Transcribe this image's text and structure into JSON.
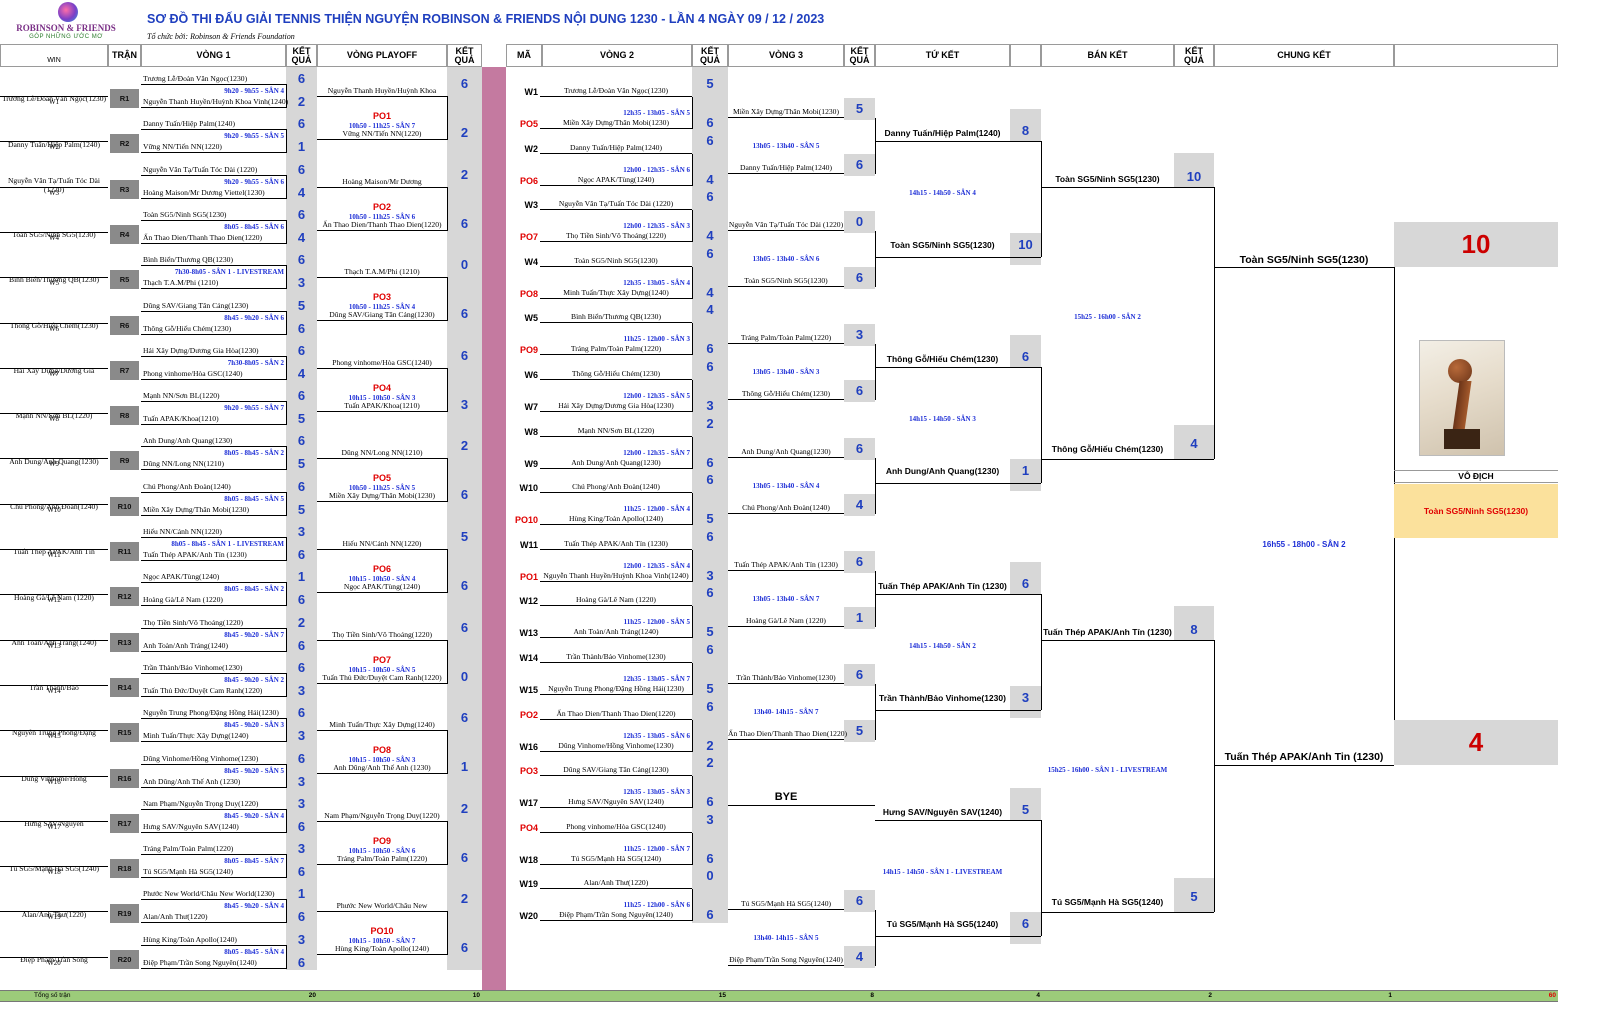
{
  "header": {
    "title": "SƠ ĐỒ THI ĐẤU GIẢI TENNIS THIỆN NGUYỆN ROBINSON & FRIENDS NỘI DUNG 1230 -  LẦN 4 NGÀY 09 / 12 / 2023",
    "organizer": "Tổ chức bởi: Robinson & Friends Foundation",
    "logo_text": "ROBINSON & FRIENDS",
    "logo_slogan": "GÓP NHỮNG ƯỚC MƠ"
  },
  "columns": {
    "win": "WIN",
    "tran": "TRẬN",
    "vong1": "VÒNG 1",
    "ketqua": "KẾT QUẢ",
    "playoff": "VÒNG PLAYOFF",
    "ma": "MÃ",
    "vong2": "VÒNG 2",
    "vong3": "VÒNG 3",
    "tuket": "TỨ KẾT",
    "banket": "BÁN KẾT",
    "chungket": "CHUNG KẾT"
  },
  "round1": [
    {
      "win": "Trương Lễ/Đoàn Văn Ngọc(1230)",
      "w": "W1",
      "r": "R1",
      "p1": "Trương Lễ/Đoàn Văn Ngọc(1230)",
      "p2": "Nguyễn Thanh Huyền/Huỳnh Khoa Vinh(1240)",
      "s1": "6",
      "s2": "2",
      "time": "9h20 - 9h55 - SÂN 4"
    },
    {
      "win": "Danny Tuấn/Hiệp Palm(1240)",
      "w": "W2",
      "r": "R2",
      "p1": "Danny Tuấn/Hiệp Palm(1240)",
      "p2": "Vững NN/Tiến NN(1220)",
      "s1": "6",
      "s2": "1",
      "time": "9h20 - 9h55 - SÂN 5"
    },
    {
      "win": "Nguyễn Văn Tạ/Tuấn Tóc Dài (1220)",
      "w": "W3",
      "r": "R3",
      "p1": "Nguyễn Văn Tạ/Tuấn Tóc Dài (1220)",
      "p2": "Hoàng Maison/Mr Dương Viettel(1230)",
      "s1": "6",
      "s2": "4",
      "time": "9h20 - 9h55 - SÂN 6"
    },
    {
      "win": "Toàn SG5/Ninh SG5(1230)",
      "w": "W4",
      "r": "R4",
      "p1": "Toàn SG5/Ninh SG5(1230)",
      "p2": "Ấn Thao Dien/Thanh Thao Dien(1220)",
      "s1": "6",
      "s2": "4",
      "time": "8h05 - 8h45 - SÂN 6"
    },
    {
      "win": "Bình Biển/Thương QB(1230)",
      "w": "W5",
      "r": "R5",
      "p1": "Bình Biển/Thương QB(1230)",
      "p2": "Thạch T.A.M/Phi (1210)",
      "s1": "6",
      "s2": "3",
      "time": "7h30-8h05 - SÂN 1 - LIVESTREAM"
    },
    {
      "win": "Thông Gỗ/Hiếu Chém(1230)",
      "w": "W6",
      "r": "R6",
      "p1": "Dũng SAV/Giang Tân Cảng(1230)",
      "p2": "Thông Gỗ/Hiếu Chém(1230)",
      "s1": "5",
      "s2": "6",
      "time": "8h45 - 9h20 - SÂN 6"
    },
    {
      "win": "Hải Xây Dựng/Dương Gia",
      "w": "W7",
      "r": "R7",
      "p1": "Hải Xây Dựng/Dương Gia Hòa(1230)",
      "p2": "Phong vinhome/Hòa GSC(1240)",
      "s1": "6",
      "s2": "4",
      "time": "7h30-8h05 - SÂN 2"
    },
    {
      "win": "Mạnh NN/Sơn BL(1220)",
      "w": "W8",
      "r": "R8",
      "p1": "Mạnh NN/Sơn BL(1220)",
      "p2": "Tuấn APAK/Khoa(1210)",
      "s1": "6",
      "s2": "5",
      "time": "9h20 - 9h55 - SÂN 7"
    },
    {
      "win": "Anh Dung/Anh Quang(1230)",
      "w": "W9",
      "r": "R9",
      "p1": "Anh Dung/Anh Quang(1230)",
      "p2": "Dũng NN/Long NN(1210)",
      "s1": "6",
      "s2": "5",
      "time": "8h05 - 8h45 - SÂN 2"
    },
    {
      "win": "Chú Phong/Anh Đoàn(1240)",
      "w": "W10",
      "r": "R10",
      "p1": "Chú Phong/Anh Đoàn(1240)",
      "p2": "Miền Xây Dựng/Thân Mobi(1230)",
      "s1": "6",
      "s2": "5",
      "time": "8h05 - 8h45 - SÂN 5"
    },
    {
      "win": "Tuấn Thép APAK/Anh Tín",
      "w": "W11",
      "r": "R11",
      "p1": "Hiếu NN/Cảnh NN(1220)",
      "p2": "Tuấn Thép APAK/Anh Tín (1230)",
      "s1": "3",
      "s2": "6",
      "time": "8h05 - 8h45 - SÂN 1 - LIVESTREAM"
    },
    {
      "win": "Hoàng Gà/Lê Nam (1220)",
      "w": "W12",
      "r": "R12",
      "p1": "Ngọc APAK/Tùng(1240)",
      "p2": "Hoàng Gà/Lê Nam (1220)",
      "s1": "1",
      "s2": "6",
      "time": "8h05 - 8h45 - SÂN 2"
    },
    {
      "win": "Anh Toàn/Anh Tráng(1240)",
      "w": "W13",
      "r": "R13",
      "p1": "Thọ Tiền Sinh/Võ Thoảng(1220)",
      "p2": "Anh Toàn/Anh Tráng(1240)",
      "s1": "2",
      "s2": "6",
      "time": "8h45 - 9h20 - SÂN 7"
    },
    {
      "win": "Trần Thành/Bảo",
      "w": "W14",
      "r": "R14",
      "p1": "Trần Thành/Bảo Vinhome(1230)",
      "p2": "Tuấn Thủ Đức/Duyệt Cam Ranh(1220)",
      "s1": "6",
      "s2": "3",
      "time": "8h45 - 9h20 - SÂN 2"
    },
    {
      "win": "Nguyễn Trung Phong/Đặng",
      "w": "W15",
      "r": "R15",
      "p1": "Nguyễn Trung Phong/Đặng Hồng Hải(1230)",
      "p2": "Minh Tuấn/Thực Xây Dựng(1240)",
      "s1": "6",
      "s2": "3",
      "time": "8h45 - 9h20 - SÂN 3"
    },
    {
      "win": "Dũng Vinhome/Hồng",
      "w": "W16",
      "r": "R16",
      "p1": "Dũng Vinhome/Hồng Vinhome(1230)",
      "p2": "Anh Dũng/Anh Thế Anh (1230)",
      "s1": "6",
      "s2": "3",
      "time": "8h45 - 9h20 - SÂN 5"
    },
    {
      "win": "Hưng SAV/Nguyên",
      "w": "W17",
      "r": "R17",
      "p1": "Nam Phạm/Nguyễn Trọng Duy(1220)",
      "p2": "Hưng SAV/Nguyên SAV(1240)",
      "s1": "3",
      "s2": "6",
      "time": "8h45 - 9h20 - SÂN 4"
    },
    {
      "win": "Tú SG5/Mạnh Hà SG5(1240)",
      "w": "W18",
      "r": "R18",
      "p1": "Tráng Palm/Toàn Palm(1220)",
      "p2": "Tú SG5/Mạnh Hà SG5(1240)",
      "s1": "3",
      "s2": "6",
      "time": "8h05 - 8h45 - SÂN 7"
    },
    {
      "win": "Alan/Anh Thư(1220)",
      "w": "W19",
      "r": "R19",
      "p1": "Phước New World/Châu New World(1230)",
      "p2": "Alan/Anh Thư(1220)",
      "s1": "1",
      "s2": "6",
      "time": "8h45 - 9h20 - SÂN 4"
    },
    {
      "win": "Điệp Phạm/Trần Song",
      "w": "W20",
      "r": "R20",
      "p1": "Hùng King/Toàn Apollo(1240)",
      "p2": "Điệp Phạm/Trần Song Nguyên(1240)",
      "s1": "3",
      "s2": "6",
      "time": "8h05 - 8h45 - SÂN 4"
    }
  ],
  "playoff": [
    {
      "top": "Nguyễn Thanh Huyền/Huỳnh Khoa",
      "ts": "6",
      "po": "PO1",
      "time": "10h50 - 11h25 - SÂN 7",
      "bot": "Vững NN/Tiến NN(1220)",
      "bs": "2"
    },
    {
      "top": "Hoàng Maison/Mr Dương",
      "ts": "2",
      "po": "PO2",
      "time": "10h50 - 11h25 - SÂN 6",
      "bot": "Ấn Thao Dien/Thanh Thao Dien(1220)",
      "bs": "6"
    },
    {
      "top": "Thạch T.A.M/Phi (1210)",
      "ts": "0",
      "po": "PO3",
      "time": "10h50 - 11h25 - SÂN 4",
      "bot": "Dũng SAV/Giang Tân Cảng(1230)",
      "bs": "6"
    },
    {
      "top": "Phong vinhome/Hòa GSC(1240)",
      "ts": "6",
      "po": "PO4",
      "time": "10h15 - 10h50 - SÂN 3",
      "bot": "Tuấn APAK/Khoa(1210)",
      "bs": "3"
    },
    {
      "top": "Dũng NN/Long NN(1210)",
      "ts": "2",
      "po": "PO5",
      "time": "10h50 - 11h25 - SÂN 5",
      "bot": "Miền Xây Dựng/Thân Mobi(1230)",
      "bs": "6"
    },
    {
      "top": "Hiếu NN/Cảnh NN(1220)",
      "ts": "5",
      "po": "PO6",
      "time": "10h15 - 10h50 - SÂN 4",
      "bot": "Ngọc APAK/Tùng(1240)",
      "bs": "6"
    },
    {
      "top": "Thọ Tiền Sinh/Võ Thoảng(1220)",
      "ts": "6",
      "po": "PO7",
      "time": "10h15 - 10h50 - SÂN 5",
      "bot": "Tuấn Thủ Đức/Duyệt Cam Ranh(1220)",
      "bs": "0"
    },
    {
      "top": "Minh Tuấn/Thực Xây Dựng(1240)",
      "ts": "6",
      "po": "PO8",
      "time": "10h15 - 10h50 - SÂN 3",
      "bot": "Anh Dũng/Anh Thế Anh (1230)",
      "bs": "1"
    },
    {
      "top": "Nam Phạm/Nguyễn Trọng Duy(1220)",
      "ts": "2",
      "po": "PO9",
      "time": "10h15 - 10h50 - SÂN 6",
      "bot": "Tráng Palm/Toàn Palm(1220)",
      "bs": "6"
    },
    {
      "top": "Phước New World/Châu New",
      "ts": "2",
      "po": "PO10",
      "time": "10h15 - 10h50 - SÂN 7",
      "bot": "Hùng King/Toàn Apollo(1240)",
      "bs": "6"
    }
  ],
  "round2": [
    {
      "tc": "W1",
      "tn": "Trương Lễ/Đoàn Văn Ngọc(1230)",
      "ts": "5",
      "bc": "PO5",
      "bn": "Miền Xây Dựng/Thân Mobi(1230)",
      "bs": "6",
      "time": "12h35 - 13h05 - SÂN 5"
    },
    {
      "tc": "W2",
      "tn": "Danny Tuấn/Hiệp Palm(1240)",
      "ts": "6",
      "bc": "PO6",
      "bn": "Ngọc APAK/Tùng(1240)",
      "bs": "4",
      "time": "12h00 - 12h35 - SÂN 6"
    },
    {
      "tc": "W3",
      "tn": "Nguyễn Văn Tạ/Tuấn Tóc Dài (1220)",
      "ts": "6",
      "bc": "PO7",
      "bn": "Thọ Tiền Sinh/Võ Thoảng(1220)",
      "bs": "4",
      "time": "12h00 - 12h35 - SÂN 3"
    },
    {
      "tc": "W4",
      "tn": "Toàn SG5/Ninh SG5(1230)",
      "ts": "6",
      "bc": "PO8",
      "bn": "Minh Tuấn/Thực Xây Dựng(1240)",
      "bs": "4",
      "time": "12h35 - 13h05 - SÂN 4"
    },
    {
      "tc": "W5",
      "tn": "Bình Biển/Thương QB(1230)",
      "ts": "4",
      "bc": "PO9",
      "bn": "Tráng Palm/Toàn Palm(1220)",
      "bs": "6",
      "time": "11h25 - 12h00 - SÂN 3"
    },
    {
      "tc": "W6",
      "tn": "Thông Gỗ/Hiếu Chém(1230)",
      "ts": "6",
      "bc": "W7",
      "bn": "Hải Xây Dựng/Dương Gia Hòa(1230)",
      "bs": "3",
      "time": "12h00 - 12h35 - SÂN 5"
    },
    {
      "tc": "W8",
      "tn": "Mạnh NN/Sơn BL(1220)",
      "ts": "2",
      "bc": "W9",
      "bn": "Anh Dung/Anh Quang(1230)",
      "bs": "6",
      "time": "12h00 - 12h35 - SÂN 7"
    },
    {
      "tc": "W10",
      "tn": "Chú Phong/Anh Đoàn(1240)",
      "ts": "6",
      "bc": "PO10",
      "bn": "Hùng King/Toàn Apollo(1240)",
      "bs": "5",
      "time": "11h25 - 12h00 - SÂN 4"
    },
    {
      "tc": "W11",
      "tn": "Tuấn Thép APAK/Anh Tín (1230)",
      "ts": "6",
      "bc": "PO1",
      "bn": "Nguyễn Thanh Huyền/Huỳnh Khoa Vinh(1240)",
      "bs": "3",
      "time": "12h00 - 12h35 - SÂN 4"
    },
    {
      "tc": "W12",
      "tn": "Hoàng Gà/Lê Nam (1220)",
      "ts": "6",
      "bc": "W13",
      "bn": "Anh Toàn/Anh Tráng(1240)",
      "bs": "5",
      "time": "11h25 - 12h00 - SÂN 5"
    },
    {
      "tc": "W14",
      "tn": "Trần Thành/Bảo Vinhome(1230)",
      "ts": "6",
      "bc": "W15",
      "bn": "Nguyễn Trung Phong/Đặng Hồng Hải(1230)",
      "bs": "5",
      "time": "12h35 - 13h05 - SÂN 7"
    },
    {
      "tc": "PO2",
      "tn": "Ấn Thao Dien/Thanh Thao Dien(1220)",
      "ts": "6",
      "bc": "W16",
      "bn": "Dũng Vinhome/Hồng Vinhome(1230)",
      "bs": "2",
      "time": "12h35 - 13h05 - SÂN 6"
    },
    {
      "tc": "PO3",
      "tn": "Dũng SAV/Giang Tân Cảng(1230)",
      "ts": "2",
      "bc": "W17",
      "bn": "Hưng SAV/Nguyên SAV(1240)",
      "bs": "6",
      "time": "12h35 - 13h05 - SÂN 3"
    },
    {
      "tc": "PO4",
      "tn": "Phong vinhome/Hòa GSC(1240)",
      "ts": "3",
      "bc": "W18",
      "bn": "Tú SG5/Mạnh Hà SG5(1240)",
      "bs": "6",
      "time": "11h25 - 12h00 - SÂN 7"
    },
    {
      "tc": "W19",
      "tn": "Alan/Anh Thư(1220)",
      "ts": "0",
      "bc": "W20",
      "bn": "Điệp Phạm/Trần Song Nguyên(1240)",
      "bs": "6",
      "time": "11h25 - 12h00 - SÂN 6"
    }
  ],
  "round3": [
    {
      "top": "Miền Xây Dựng/Thân Mobi(1230)",
      "ts": "5",
      "time": "13h05 - 13h40 - SÂN 5",
      "bot": "Danny Tuấn/Hiệp Palm(1240)",
      "bs": "6"
    },
    {
      "top": "Nguyễn Văn Tạ/Tuấn Tóc Dài (1220)",
      "ts": "0",
      "time": "13h05 - 13h40 - SÂN 6",
      "bot": "Toàn SG5/Ninh SG5(1230)",
      "bs": "6"
    },
    {
      "top": "Tráng Palm/Toàn Palm(1220)",
      "ts": "3",
      "time": "13h05 - 13h40 - SÂN 3",
      "bot": "Thông Gỗ/Hiếu Chém(1230)",
      "bs": "6"
    },
    {
      "top": "Anh Dung/Anh Quang(1230)",
      "ts": "6",
      "time": "13h05 - 13h40 - SÂN 4",
      "bot": "Chú Phong/Anh Đoàn(1240)",
      "bs": "4"
    },
    {
      "top": "Tuấn Thép APAK/Anh Tín (1230)",
      "ts": "6",
      "time": "13h05 - 13h40 - SÂN 7",
      "bot": "Hoàng Gà/Lê Nam (1220)",
      "bs": "1"
    },
    {
      "top": "Trần Thành/Bảo Vinhome(1230)",
      "ts": "6",
      "time": "13h40- 14h15 - SÂN 7",
      "bot": "Ấn Thao Dien/Thanh Thao Dien(1220)",
      "bs": "5"
    },
    {
      "top": "BYE",
      "ts": "",
      "time": "",
      "bot": "",
      "bs": ""
    },
    {
      "top": "Tú SG5/Mạnh Hà SG5(1240)",
      "ts": "6",
      "time": "13h40- 14h15 - SÂN 5",
      "bot": "Điệp Phạm/Trần Song Nguyên(1240)",
      "bs": "4"
    }
  ],
  "quarter": [
    {
      "top": "Danny Tuấn/Hiệp Palm(1240)",
      "ts": "8",
      "time": "14h15 - 14h50 - SÂN 4",
      "bot": "Toàn SG5/Ninh SG5(1230)",
      "bs": "10"
    },
    {
      "top": "Thông Gỗ/Hiếu Chém(1230)",
      "ts": "6",
      "time": "14h15 - 14h50 - SÂN 3",
      "bot": "Anh Dung/Anh Quang(1230)",
      "bs": "1"
    },
    {
      "top": "Tuấn Thép APAK/Anh Tín (1230)",
      "ts": "6",
      "time": "14h15 - 14h50 - SÂN 2",
      "bot": "Trần Thành/Bảo Vinhome(1230)",
      "bs": "3"
    },
    {
      "top": "Hưng SAV/Nguyên SAV(1240)",
      "ts": "5",
      "time": "14h15 - 14h50 - SÂN 1 - LIVESTREAM",
      "bot": "Tú SG5/Mạnh Hà SG5(1240)",
      "bs": "6"
    }
  ],
  "semi": [
    {
      "top": "Toàn SG5/Ninh SG5(1230)",
      "ts": "10",
      "time": "15h25 - 16h00 - SÂN 2",
      "bot": "Thông Gỗ/Hiếu Chém(1230)",
      "bs": "4"
    },
    {
      "top": "Tuấn Thép APAK/Anh Tín (1230)",
      "ts": "8",
      "time": "15h25 - 16h00 - SÂN 1 - LIVESTREAM",
      "bot": "Tú SG5/Mạnh Hà SG5(1240)",
      "bs": "5"
    }
  ],
  "final": {
    "top": "Toàn SG5/Ninh SG5(1230)",
    "ts": "10",
    "time": "16h55 - 18h00 - SÂN 2",
    "bot": "Tuấn Thép APAK/Anh Tin (1230)",
    "bs": "4",
    "champion_label": "VÔ ĐỊCH",
    "champion": "Toàn SG5/Ninh SG5(1230)"
  },
  "footer": {
    "label": "Tổng số trận",
    "v1": "20",
    "po": "10",
    "v2": "15",
    "v3": "8",
    "qf": "4",
    "sf": "2",
    "f": "1",
    "total": "60"
  },
  "colors": {
    "title": "#1f3fbf",
    "score": "#1f3fbf",
    "time": "#1e2fd6",
    "playoff_code": "#e00000",
    "divider": "#c47aa0",
    "footer": "#9ccb7a",
    "champion_bg": "#fbe19c",
    "champion_text": "#e00000",
    "big_score": "#cc0000"
  }
}
